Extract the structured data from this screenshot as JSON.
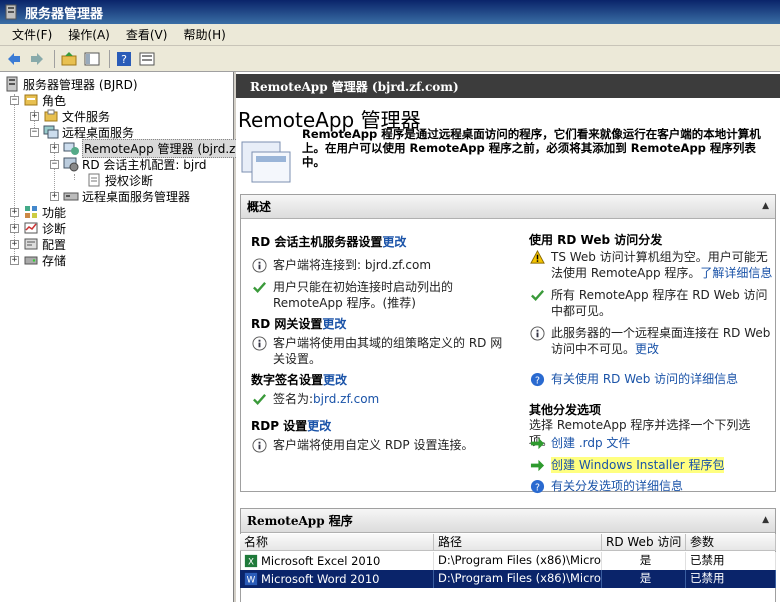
{
  "window": {
    "title": "服务器管理器"
  },
  "menu": [
    "文件(F)",
    "操作(A)",
    "查看(V)",
    "帮助(H)"
  ],
  "tree": {
    "root": "服务器管理器 (BJRD)",
    "roles": "角色",
    "file_services": "文件服务",
    "rds": "远程桌面服务",
    "remoteapp": "RemoteApp 管理器 (bjrd.zf",
    "rdsh_config": "RD 会话主机配置: bjrd",
    "licensing_diag": "授权诊断",
    "rds_manager": "远程桌面服务管理器",
    "features": "功能",
    "diagnostics": "诊断",
    "config": "配置",
    "storage": "存储"
  },
  "header": {
    "title": "RemoteApp 管理器 (bjrd.zf.com)"
  },
  "main": {
    "title": "RemoteApp 管理器",
    "description": "RemoteApp 程序是通过远程桌面访问的程序，它们看来就像运行在客户端的本地计算机上。在用户可以使用 RemoteApp 程序之前，必须将其添加到 RemoteApp 程序列表中。"
  },
  "overview": {
    "title": "概述",
    "rdsh": {
      "title": "RD 会话主机服务器设置",
      "change": "更改",
      "items": [
        "客户端将连接到: bjrd.zf.com",
        "用户只能在初始连接时启动列出的 RemoteApp 程序。(推荐)"
      ]
    },
    "gateway": {
      "title": "RD 网关设置",
      "change": "更改",
      "items": [
        "客户端将使用由其域的组策略定义的 RD 网关设置。"
      ]
    },
    "signature": {
      "title": "数字签名设置",
      "change": "更改",
      "label": "签名为: ",
      "value": "bjrd.zf.com"
    },
    "rdp": {
      "title": "RDP 设置",
      "change": "更改",
      "items": [
        "客户端将使用自定义 RDP 设置连接。"
      ]
    },
    "web": {
      "title": "使用 RD Web 访问分发",
      "warn": "TS Web 访问计算机组为空。用户可能无法使用 RemoteApp 程序。",
      "warn_link": "了解详细信息",
      "ok": "所有 RemoteApp 程序在 RD Web 访问中都可见。",
      "info": "此服务器的一个远程桌面连接在 RD Web 访问中不可见。",
      "info_link": "更改",
      "more": "有关使用 RD Web 访问的详细信息"
    },
    "other": {
      "title": "其他分发选项",
      "desc": "选择 RemoteApp 程序并选择一个下列选项。",
      "rdp_file": "创建 .rdp 文件",
      "msi": "创建 Windows Installer 程序包",
      "more": "有关分发选项的详细信息"
    }
  },
  "programs": {
    "title": "RemoteApp 程序",
    "columns": [
      "名称",
      "路径",
      "RD Web 访问",
      "参数"
    ],
    "rows": [
      {
        "name": "Microsoft Excel 2010",
        "path": "D:\\Program Files (x86)\\Micros...",
        "web": "是",
        "args": "已禁用"
      },
      {
        "name": "Microsoft Word 2010",
        "path": "D:\\Program Files (x86)\\Micros...",
        "web": "是",
        "args": "已禁用"
      }
    ]
  }
}
